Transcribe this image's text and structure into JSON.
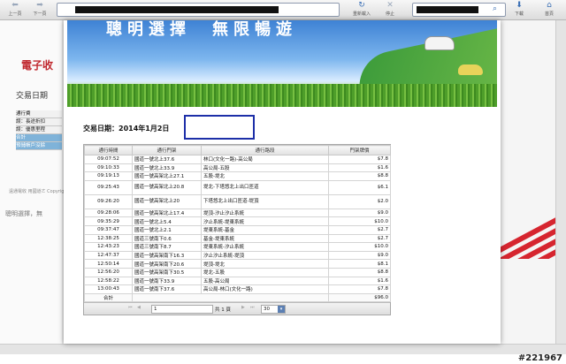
{
  "toolbar": {
    "back": "上一頁",
    "forward": "下一頁",
    "reload": "重新載入",
    "stop": "停止",
    "download": "下載",
    "home": "首頁"
  },
  "background": {
    "brand": "電子收",
    "section": "交易日期",
    "menu": [
      "通行費",
      "誤：長途折扣",
      "誤：優惠里程",
      "合計",
      "預儲帳戶沒餘"
    ],
    "footer": "遠通電收 用國道ㄜ Copyright@2013",
    "slogan": "聰明選擇，無"
  },
  "banner": {
    "title": "聰明選擇　無限暢遊"
  },
  "date": {
    "label": "交易日期：2014年1月2日"
  },
  "table": {
    "headers": [
      "通行時間",
      "通行門架",
      "通行路段",
      "門架牌價"
    ],
    "rows": [
      [
        "09:07:52",
        "國道一號北上37.6",
        "林口(文化一路)-高公局",
        "$7.8"
      ],
      [
        "09:10:33",
        "國道一號北上33.9",
        "高公局-五股",
        "$1.6"
      ],
      [
        "09:19:13",
        "國道一號高架北上27.1",
        "五股-堤北",
        "$8.8"
      ],
      [
        "09:25:43",
        "國道一號高架北上20.8",
        "堤北-下塔悠北上出口匝道",
        "$6.1"
      ],
      [
        "09:26:20",
        "國道一號高架北上20",
        "下塔悠北上出口匝道-堤頂",
        "$2.0"
      ],
      [
        "09:28:06",
        "國道一號高架北上17.4",
        "堤頂-汐止汐止系統",
        "$9.0"
      ],
      [
        "09:35:29",
        "國道一號北上5.4",
        "汐止系統-堤東系統",
        "$10.0"
      ],
      [
        "09:37:47",
        "國道一號北上2.1",
        "堤東系統-基金",
        "$2.7"
      ],
      [
        "12:38:25",
        "國道三號南下0.6",
        "基金-堤東系統",
        "$2.7"
      ],
      [
        "12:43:23",
        "國道三號南下8.7",
        "堤東系統-汐止系統",
        "$10.0"
      ],
      [
        "12:47:37",
        "國道一號高架南下16.3",
        "汐止汐止系統-堤頂",
        "$9.0"
      ],
      [
        "12:50:14",
        "國道一號高架南下20.6",
        "堤頂-堤北",
        "$8.1"
      ],
      [
        "12:56:20",
        "國道一號高架南下30.5",
        "堤北-五股",
        "$8.8"
      ],
      [
        "12:58:22",
        "國道一號南下33.9",
        "五股-高公局",
        "$1.6"
      ],
      [
        "13:00:43",
        "國道一號南下37.6",
        "高公局-林口(文化一路)",
        "$7.8"
      ]
    ],
    "total_label": "合計",
    "total_value": "$96.0"
  },
  "pager": {
    "page": "1",
    "of": "共 1 頁",
    "size": "30"
  },
  "watermark": "#221967"
}
